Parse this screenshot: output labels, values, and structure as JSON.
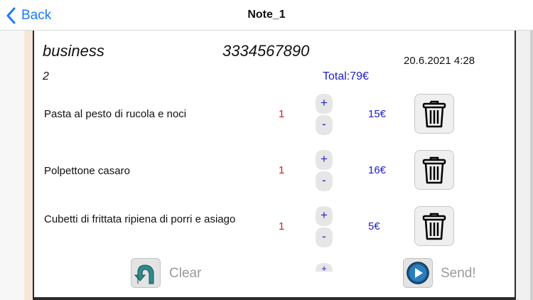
{
  "nav": {
    "back_label": "Back",
    "title": "Note_1"
  },
  "order": {
    "customer": "business",
    "phone": "3334567890",
    "datetime": "20.6.2021 4:28",
    "count": "2",
    "total": "Total:79€"
  },
  "items": [
    {
      "name": "Pasta al pesto di rucola e noci",
      "qty": "1",
      "plus": "+",
      "minus": "-",
      "price": "15€"
    },
    {
      "name": "Polpettone casaro",
      "qty": "1",
      "plus": "+",
      "minus": "-",
      "price": "16€"
    },
    {
      "name": "Cubetti di frittata ripiena di porri e asiago",
      "qty": "1",
      "plus": "+",
      "minus": "-",
      "price": "5€"
    }
  ],
  "partial_row": {
    "plus": "+"
  },
  "actions": {
    "clear_label": "Clear",
    "send_label": "Send!"
  },
  "icons": {
    "back": "chevron-left-icon",
    "delete": "trash-icon",
    "clear": "undo-arrow-icon",
    "send": "play-icon"
  },
  "colors": {
    "accent": "#1a7cf5",
    "qty": "#e01818",
    "price": "#2020c8"
  }
}
